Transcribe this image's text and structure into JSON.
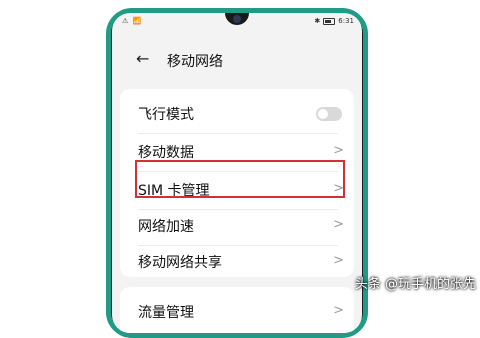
{
  "statusbar": {
    "left_icons": "⚠ 📶",
    "right_text": "6:31"
  },
  "header": {
    "back_icon": "←",
    "title": "移动网络"
  },
  "settings": [
    {
      "label": "飞行模式",
      "type": "toggle",
      "on": false
    },
    {
      "label": "移动数据",
      "type": "link"
    },
    {
      "label": "SIM 卡管理",
      "type": "link",
      "highlighted": true
    },
    {
      "label": "网络加速",
      "type": "link"
    },
    {
      "label": "移动网络共享",
      "type": "link"
    }
  ],
  "settings2": [
    {
      "label": "流量管理",
      "type": "link"
    }
  ],
  "chevron": ">",
  "highlight_color": "#d0303a",
  "phone_frame_color": "#1f9b86",
  "watermark": "头条 @玩手机的张先"
}
